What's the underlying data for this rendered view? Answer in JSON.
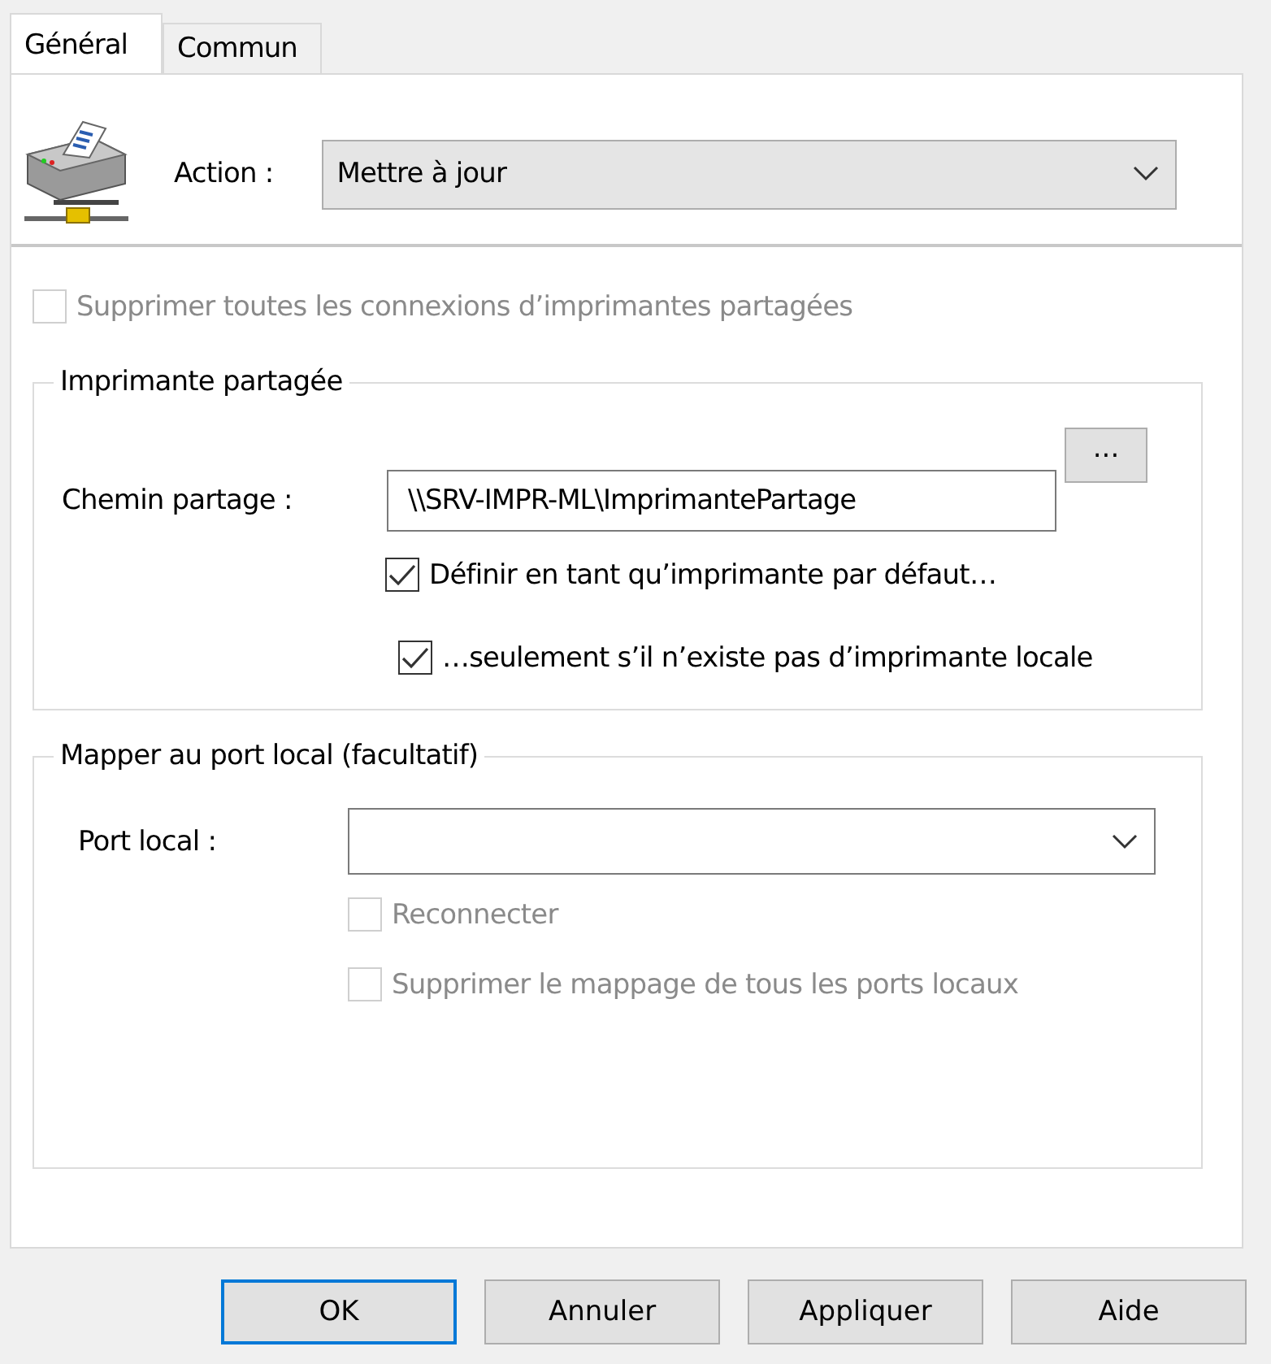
{
  "tabs": [
    {
      "label": "Général",
      "selected": true
    },
    {
      "label": "Commun",
      "selected": false
    }
  ],
  "action": {
    "label": "Action :",
    "value": "Mettre à jour"
  },
  "remove_all": {
    "label": "Supprimer toutes les connexions d’imprimantes partagées",
    "checked": false,
    "disabled": true
  },
  "shared_printer": {
    "legend": "Imprimante partagée",
    "path_label": "Chemin partage :",
    "path_value": "\\\\SRV-IMPR-ML\\ImprimantePartage",
    "browse_button": "...",
    "options": [
      {
        "label": "Définir en tant qu’imprimante par défaut…",
        "checked": true,
        "disabled": false
      },
      {
        "label": "…seulement s’il n’existe pas d’imprimante locale",
        "checked": true,
        "disabled": false
      }
    ]
  },
  "local_port": {
    "legend": "Mapper au port local (facultatif)",
    "port_label": "Port local :",
    "options": [
      {
        "label": "Reconnecter",
        "checked": false,
        "disabled": true
      },
      {
        "label": "Supprimer le mappage de tous les ports locaux",
        "checked": false,
        "disabled": true
      }
    ]
  },
  "buttons": [
    {
      "label": "OK",
      "default": true
    },
    {
      "label": "Annuler",
      "default": false
    },
    {
      "label": "Appliquer",
      "default": false
    },
    {
      "label": "Aide",
      "default": false
    }
  ]
}
